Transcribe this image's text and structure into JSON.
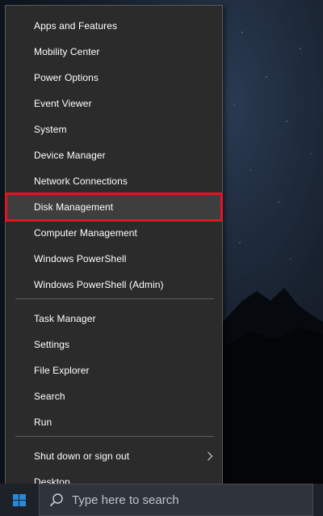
{
  "menu": {
    "groups": [
      [
        "Apps and Features",
        "Mobility Center",
        "Power Options",
        "Event Viewer",
        "System",
        "Device Manager",
        "Network Connections",
        "Disk Management",
        "Computer Management",
        "Windows PowerShell",
        "Windows PowerShell (Admin)"
      ],
      [
        "Task Manager",
        "Settings",
        "File Explorer",
        "Search",
        "Run"
      ],
      [
        "Shut down or sign out",
        "Desktop"
      ]
    ],
    "selected": "Disk Management",
    "submenu_item": "Shut down or sign out",
    "highlight_color": "#e81123"
  },
  "taskbar": {
    "search_placeholder": "Type here to search",
    "start_icon": "windows-logo-icon",
    "search_icon": "search-icon"
  },
  "colors": {
    "menu_bg": "#2b2b2b",
    "menu_text": "#ffffff",
    "selected_outline": "#e81123",
    "taskbar_bg": "#1d2128",
    "accent": "#0078d7"
  }
}
